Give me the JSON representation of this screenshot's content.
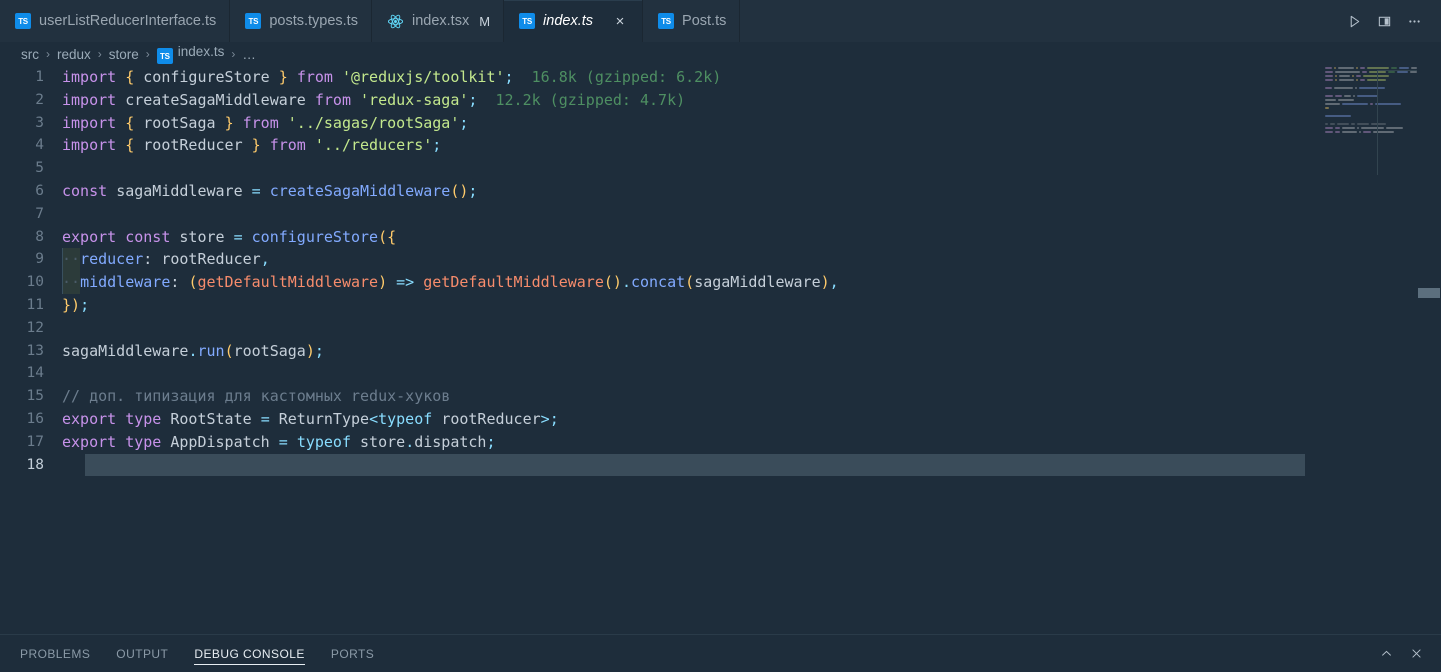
{
  "window": {
    "background": "#1e2d3b",
    "accent": "#0f8ce9"
  },
  "tabbar": {
    "tabs": [
      {
        "label": "userListReducerInterface.ts",
        "icon": "typescript-file-icon",
        "icon_text": "TS",
        "active": false,
        "dirty": "",
        "closable": false
      },
      {
        "label": "posts.types.ts",
        "icon": "typescript-file-icon",
        "icon_text": "TS",
        "active": false,
        "dirty": "",
        "closable": false
      },
      {
        "label": "index.tsx",
        "icon": "react-file-icon",
        "icon_text": "",
        "active": false,
        "dirty": "M",
        "closable": false
      },
      {
        "label": "index.ts",
        "icon": "typescript-file-icon",
        "icon_text": "TS",
        "active": true,
        "dirty": "",
        "closable": true,
        "close_label": "×"
      },
      {
        "label": "Post.ts",
        "icon": "typescript-file-icon",
        "icon_text": "TS",
        "active": false,
        "dirty": "",
        "closable": false
      }
    ],
    "actions": [
      {
        "name": "run-button",
        "glyph": "▷"
      },
      {
        "name": "split-editor-right-button",
        "glyph": "◫"
      },
      {
        "name": "more-actions-button",
        "glyph": "⋯"
      }
    ]
  },
  "breadcrumb": {
    "separator": "›",
    "items": [
      {
        "label": "src",
        "icon": ""
      },
      {
        "label": "redux",
        "icon": ""
      },
      {
        "label": "store",
        "icon": ""
      },
      {
        "label": "index.ts",
        "icon": "typescript-file-icon",
        "icon_text": "TS"
      },
      {
        "label": "…",
        "icon": ""
      }
    ]
  },
  "editor": {
    "file": "index.ts",
    "language": "typescript",
    "current_line": 18,
    "lines": [
      {
        "n": 1,
        "text": "import { configureStore } from '@reduxjs/toolkit';  16.8k (gzipped: 6.2k)"
      },
      {
        "n": 2,
        "text": "import createSagaMiddleware from 'redux-saga';  12.2k (gzipped: 4.7k)"
      },
      {
        "n": 3,
        "text": "import { rootSaga } from '../sagas/rootSaga';"
      },
      {
        "n": 4,
        "text": "import { rootReducer } from '../reducers';"
      },
      {
        "n": 5,
        "text": ""
      },
      {
        "n": 6,
        "text": "const sagaMiddleware = createSagaMiddleware();"
      },
      {
        "n": 7,
        "text": ""
      },
      {
        "n": 8,
        "text": "export const store = configureStore({"
      },
      {
        "n": 9,
        "text": "··reducer: rootReducer,"
      },
      {
        "n": 10,
        "text": "··middleware: (getDefaultMiddleware) => getDefaultMiddleware().concat(sagaMiddleware),"
      },
      {
        "n": 11,
        "text": "});"
      },
      {
        "n": 12,
        "text": ""
      },
      {
        "n": 13,
        "text": "sagaMiddleware.run(rootSaga);"
      },
      {
        "n": 14,
        "text": ""
      },
      {
        "n": 15,
        "text": "// доп. типизация для кастомных redux-хуков"
      },
      {
        "n": 16,
        "text": "export type RootState = ReturnType<typeof rootReducer>;"
      },
      {
        "n": 17,
        "text": "export type AppDispatch = typeof store.dispatch;"
      },
      {
        "n": 18,
        "text": ""
      }
    ],
    "import_costs": [
      {
        "line": 1,
        "module": "@reduxjs/toolkit",
        "size": "16.8k",
        "gzipped": "6.2k",
        "text": "16.8k (gzipped: 6.2k)"
      },
      {
        "line": 2,
        "module": "redux-saga",
        "size": "12.2k",
        "gzipped": "4.7k",
        "text": "12.2k (gzipped: 4.7k)"
      }
    ],
    "colors": {
      "keyword": "#c792ea",
      "string": "#c3e88d",
      "function": "#82aaff",
      "parameter": "#f78c6c",
      "punctuation": "#89ddff",
      "brace": "#ffcb6b",
      "variable": "#c5cfd9",
      "comment": "#6c7d8e",
      "import_cost": "#4e8f62",
      "line_number": "#6b7c8c",
      "selection": "#3a4c5a"
    }
  },
  "panel": {
    "tabs": [
      {
        "label": "PROBLEMS",
        "active": false
      },
      {
        "label": "OUTPUT",
        "active": false
      },
      {
        "label": "DEBUG CONSOLE",
        "active": true
      },
      {
        "label": "PORTS",
        "active": false
      }
    ],
    "actions": [
      {
        "name": "maximize-panel-button",
        "glyph": "∧"
      },
      {
        "name": "close-panel-button",
        "glyph": "✕"
      }
    ]
  }
}
